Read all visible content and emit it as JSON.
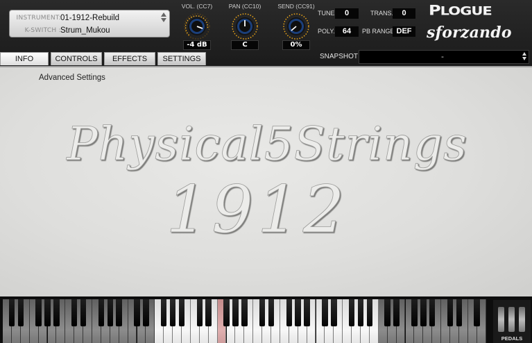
{
  "instrument": {
    "instrument_label": "INSTRUMENT:",
    "instrument_value": "01-1912-Rebuild",
    "kswitch_label": "K-SWITCH :",
    "kswitch_value": "Strum_Mukou"
  },
  "knobs": {
    "volume": {
      "label": "VOL. (CC7)",
      "value": "-4 dB"
    },
    "pan": {
      "label": "PAN (CC10)",
      "value": "C"
    },
    "send": {
      "label": "SEND (CC91)",
      "value": "0%"
    }
  },
  "params": {
    "tune": {
      "label": "TUNE",
      "value": "0"
    },
    "trans": {
      "label": "TRANS.",
      "value": "0"
    },
    "poly": {
      "label": "POLY.",
      "value": "64"
    },
    "pb_range": {
      "label": "PB RANGE",
      "value": "DEF"
    }
  },
  "logo": {
    "brand": "PLOGUE",
    "product": "sforzando"
  },
  "tabs": [
    {
      "label": "INFO",
      "active": true
    },
    {
      "label": "CONTROLS",
      "active": false
    },
    {
      "label": "EFFECTS",
      "active": false
    },
    {
      "label": "SETTINGS",
      "active": false
    }
  ],
  "snapshot": {
    "label": "SNAPSHOT",
    "value": "-"
  },
  "info": {
    "advanced_settings": "Advanced Settings",
    "title_line1": "Physical5Strings",
    "title_line2": "1912"
  },
  "pedals": {
    "label": "PEDALS"
  },
  "icons": {
    "instrument_selector": "updown-arrows-icon",
    "snapshot_selector": "updown-arrows-icon",
    "knob": "rotary-knob-icon"
  },
  "colors": {
    "header_bg": "#1f1f1f",
    "panel_bg": "#e2e2e0",
    "knob_ring": "#f0a818",
    "knob_body": "#1b3f7a",
    "key_highlight": "#d9a3a3"
  }
}
